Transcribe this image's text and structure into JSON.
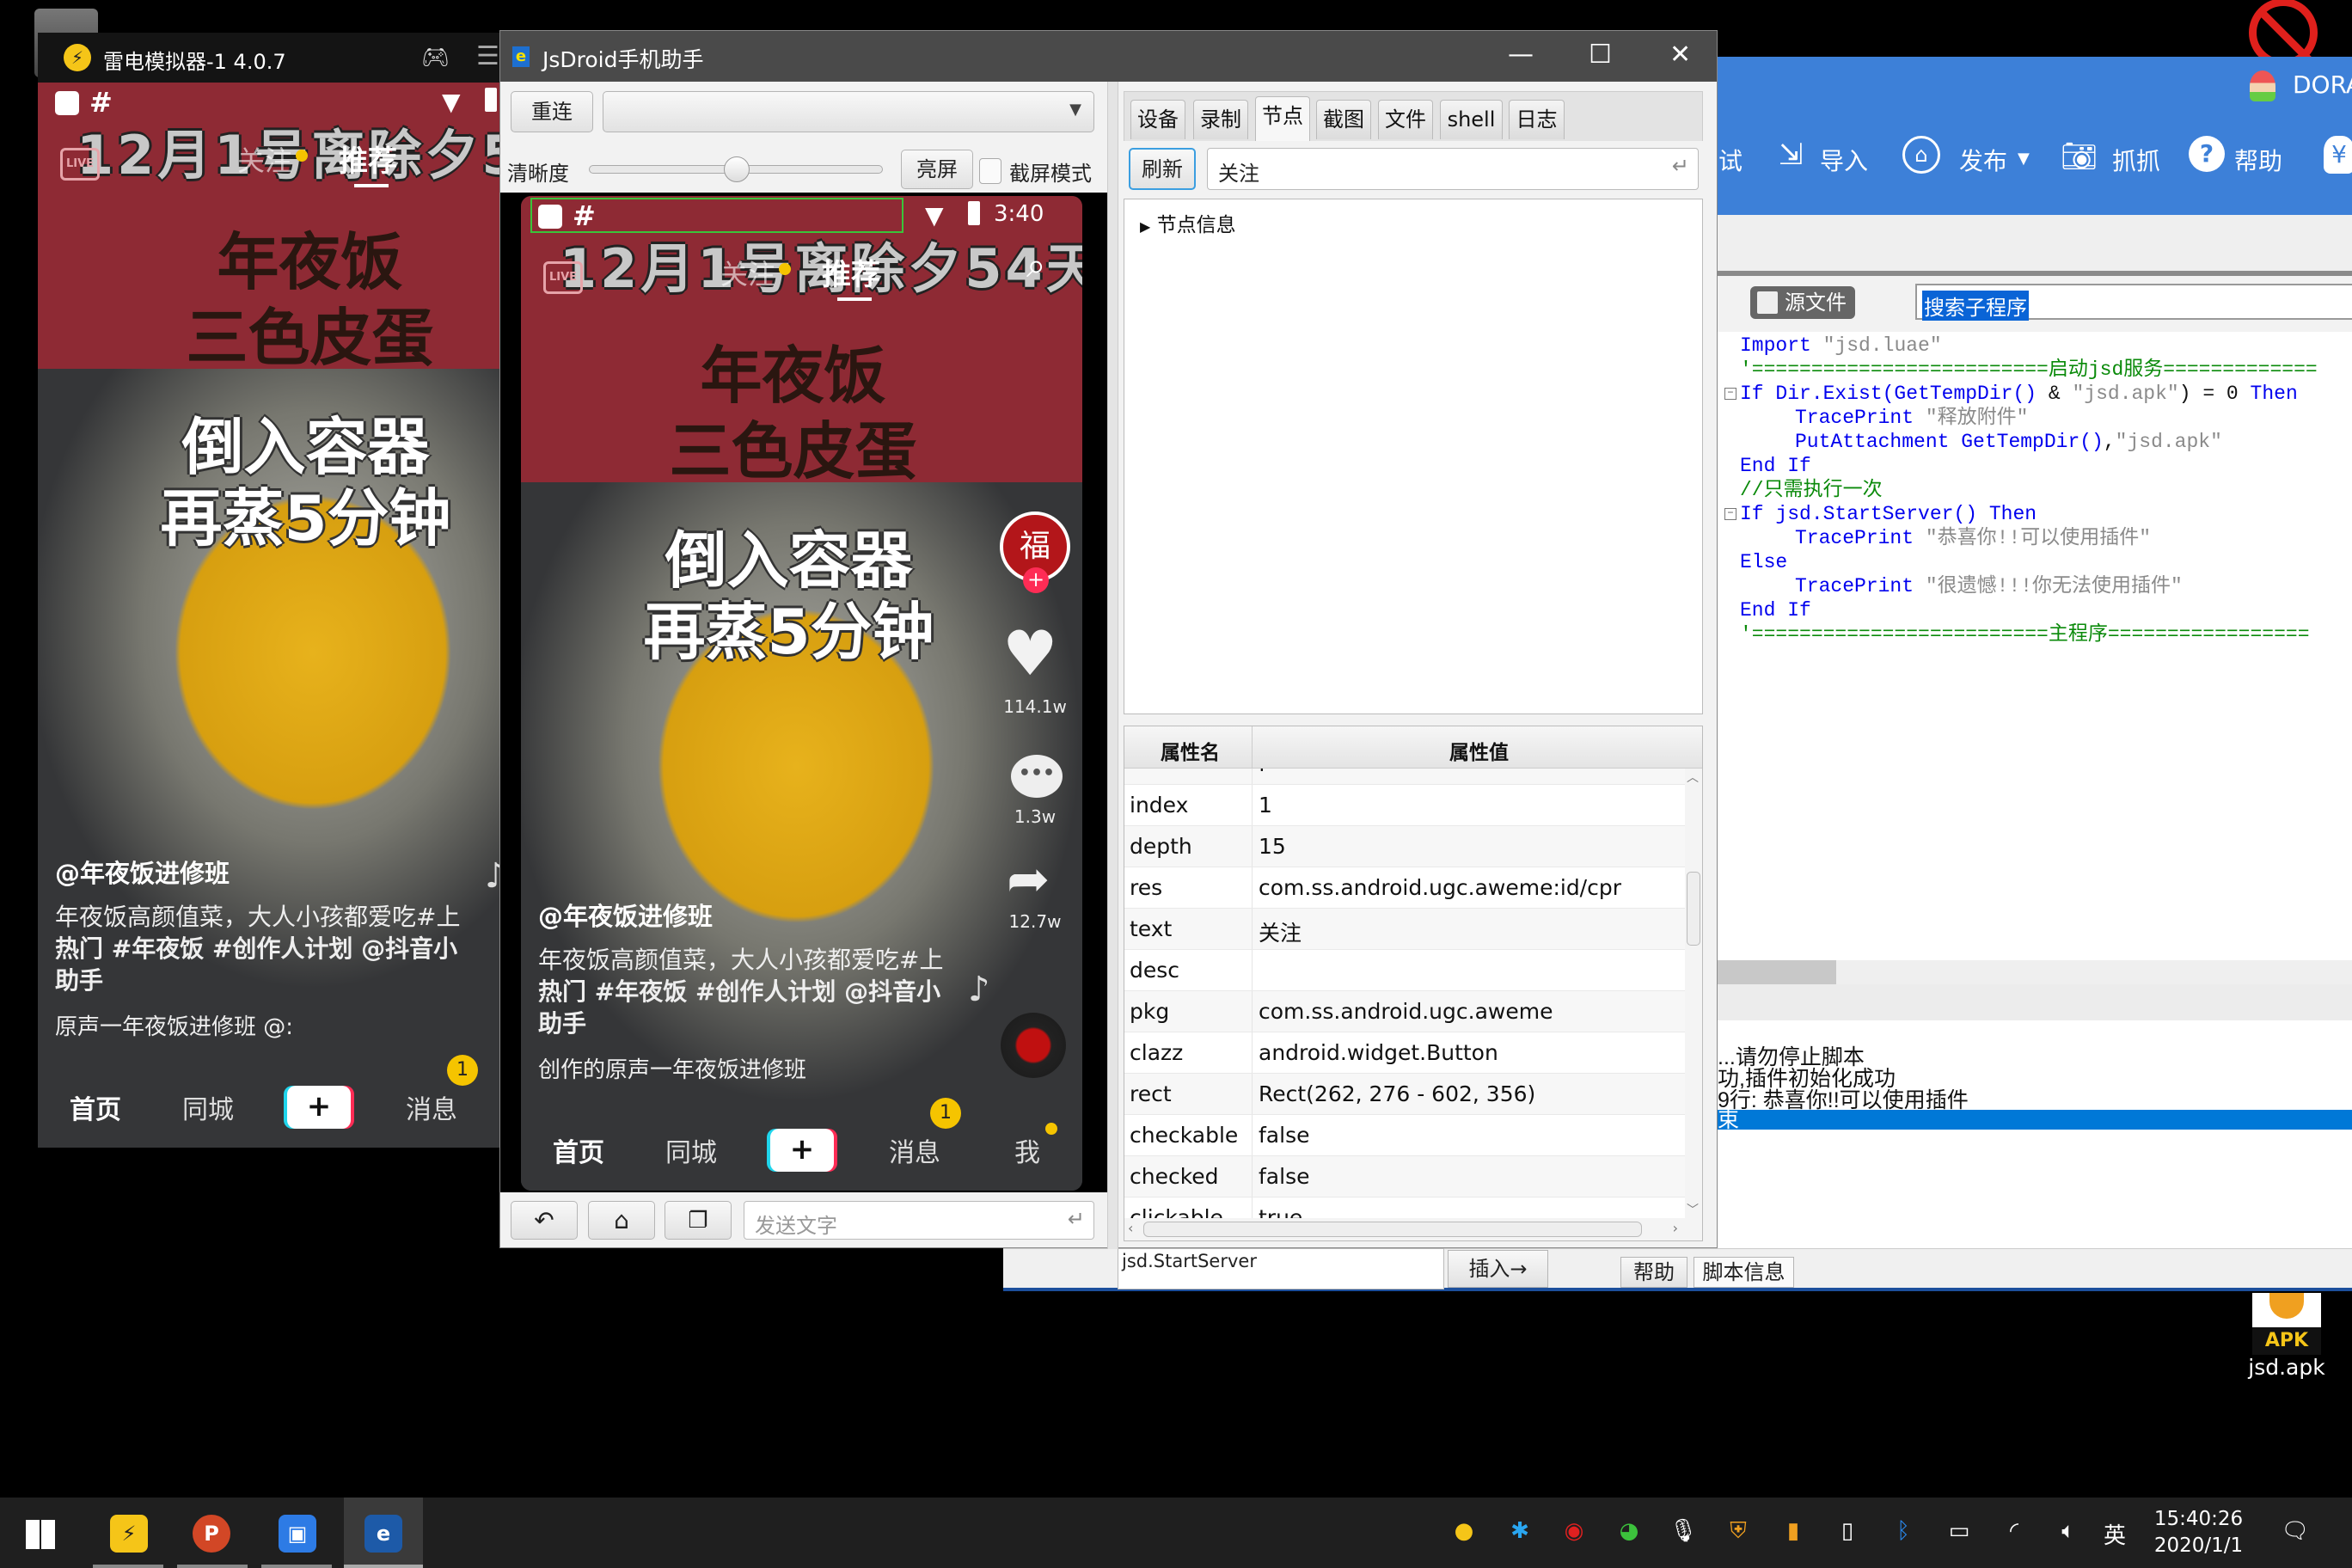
{
  "emulator": {
    "title": "雷电模拟器-1 4.0.7",
    "music": "原声一年夜饭进修班   @:"
  },
  "phone": {
    "hash": "#",
    "time": "3:40",
    "banner": "12月1号离除夕54天",
    "live": "LIVE",
    "tab_follow": "关注",
    "tab_recommend": "推荐",
    "caption1": "年夜饭",
    "caption2": "三色皮蛋",
    "overlay1": "倒入容器",
    "overlay2": "再蒸5分钟",
    "likes": "114.1w",
    "comments": "1.3w",
    "shares": "12.7w",
    "author": "@年夜饭进修班",
    "desc": [
      "年夜饭高颜值菜，大人小孩都爱吃#上",
      "热门 #年夜饭 #创作人计划 @抖音小",
      "助手"
    ],
    "music": "创作的原声一年夜饭进修班",
    "nav": [
      "首页",
      "同城",
      "+",
      "消息",
      "我"
    ],
    "badge": "1"
  },
  "jsdroid": {
    "title": "JsDroid手机助手",
    "reconnect": "重连",
    "device_select": "",
    "clarity": "清晰度",
    "clarity_level": 0.5,
    "screen_on": "亮屏",
    "screenshot_mode": "截屏模式",
    "send_placeholder": "发送文字",
    "tabs": [
      "设备",
      "录制",
      "节点",
      "截图",
      "文件",
      "shell",
      "日志"
    ],
    "active_tab": "节点",
    "refresh": "刷新",
    "query": "关注",
    "tree_root": "节点信息",
    "table": {
      "headers": [
        "属性名",
        "属性值"
      ],
      "rows": [
        [
          "",
          "f"
        ],
        [
          "index",
          "1"
        ],
        [
          "depth",
          "15"
        ],
        [
          "res",
          "com.ss.android.ugc.aweme:id/cpr"
        ],
        [
          "text",
          "关注"
        ],
        [
          "desc",
          ""
        ],
        [
          "pkg",
          "com.ss.android.ugc.aweme"
        ],
        [
          "clazz",
          "android.widget.Button"
        ],
        [
          "rect",
          "Rect(262, 276 - 602, 356)"
        ],
        [
          "checkable",
          "false"
        ],
        [
          "checked",
          "false"
        ],
        [
          "clickable",
          "true"
        ]
      ]
    }
  },
  "app": {
    "user": "DORA",
    "toolbar": [
      "试",
      "导入",
      "发布",
      "抓抓",
      "帮助"
    ],
    "source_file": "源文件",
    "search": "搜索子程序",
    "code": [
      {
        "fold": "",
        "indent": 0,
        "seg": [
          [
            "kw",
            "Import"
          ],
          [
            "st",
            " \"jsd.luae\""
          ]
        ]
      },
      {
        "fold": "",
        "indent": 0,
        "seg": [
          [
            "cm",
            "'=========================启动jsd服务============="
          ]
        ]
      },
      {
        "fold": "−",
        "indent": 0,
        "seg": [
          [
            "kw",
            "If Dir.Exist(GetTempDir()"
          ],
          [
            "pl",
            " & "
          ],
          [
            "st",
            "\"jsd.apk\""
          ],
          [
            "pl",
            ") = 0 "
          ],
          [
            "kw",
            "Then"
          ]
        ]
      },
      {
        "fold": "",
        "indent": 1,
        "seg": [
          [
            "kw",
            "TracePrint"
          ],
          [
            "st",
            " \"释放附件\""
          ]
        ]
      },
      {
        "fold": "",
        "indent": 1,
        "seg": [
          [
            "kw",
            "PutAttachment GetTempDir()"
          ],
          [
            "pl",
            ","
          ],
          [
            "st",
            "\"jsd.apk\""
          ]
        ]
      },
      {
        "fold": "",
        "indent": 0,
        "seg": [
          [
            "kw",
            "End If"
          ]
        ]
      },
      {
        "fold": "",
        "indent": 0,
        "seg": [
          [
            "cm",
            "//只需执行一次"
          ]
        ]
      },
      {
        "fold": "−",
        "indent": 0,
        "seg": [
          [
            "kw",
            "If jsd.StartServer() Then"
          ]
        ]
      },
      {
        "fold": "",
        "indent": 1,
        "seg": [
          [
            "kw",
            "TracePrint"
          ],
          [
            "st",
            " \"恭喜你!!可以使用插件\""
          ]
        ]
      },
      {
        "fold": "",
        "indent": 0,
        "seg": [
          [
            "kw",
            "Else"
          ]
        ]
      },
      {
        "fold": "",
        "indent": 1,
        "seg": [
          [
            "kw",
            "TracePrint"
          ],
          [
            "st",
            " \"很遗憾!!!你无法使用插件\""
          ]
        ]
      },
      {
        "fold": "",
        "indent": 0,
        "seg": [
          [
            "kw",
            "End If"
          ]
        ]
      },
      {
        "fold": "",
        "indent": 0,
        "seg": [
          [
            "cm",
            "'=========================主程序================="
          ]
        ]
      }
    ],
    "log": [
      "...请勿停止脚本",
      "功,插件初始化成功",
      "9行: 恭喜你!!可以使用插件",
      "束"
    ],
    "command": "jsd.StartServer",
    "insert": "插入→",
    "help": "帮助",
    "script_info": "脚本信息",
    "accent": "#3d80d8"
  },
  "desktop": {
    "icon_badge": "APK",
    "icon_label": "jsd.apk"
  },
  "taskbar": {
    "apps": [
      "leidian-icon",
      "powerpoint-icon",
      "remote-desktop-icon",
      "jsdroid-icon"
    ],
    "ime": "英",
    "time": "15:40:26",
    "date": "2020/1/1"
  }
}
